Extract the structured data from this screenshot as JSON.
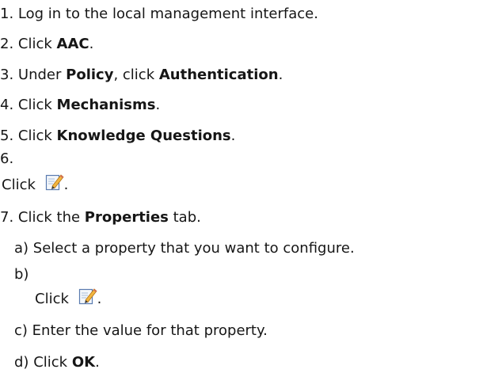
{
  "steps": [
    {
      "num": "1.",
      "text": "Log in to the local management interface."
    },
    {
      "num": "2.",
      "pre": "Click ",
      "bold": "AAC",
      "post": "."
    },
    {
      "num": "3.",
      "pre": "Under ",
      "bold": "Policy",
      "mid": ", click ",
      "bold2": "Authentication",
      "post": "."
    },
    {
      "num": "4.",
      "pre": "Click ",
      "bold": "Mechanisms",
      "post": "."
    },
    {
      "num": "5.",
      "pre": "Click ",
      "bold": "Knowledge Questions",
      "post": "."
    },
    {
      "num": "6.",
      "pre": "Click ",
      "icon": "edit-pencil-icon",
      "post": "."
    },
    {
      "num": "7.",
      "pre": "Click the ",
      "bold": "Properties",
      "post": " tab."
    }
  ],
  "substeps": [
    {
      "letter": "a)",
      "text": "Select a property that you want to configure."
    },
    {
      "letter": "b)",
      "pre": "Click ",
      "icon": "edit-pencil-icon",
      "post": "."
    },
    {
      "letter": "c)",
      "text": "Enter the value for that property."
    },
    {
      "letter": "d)",
      "pre": "Click ",
      "bold": "OK",
      "post": "."
    }
  ]
}
